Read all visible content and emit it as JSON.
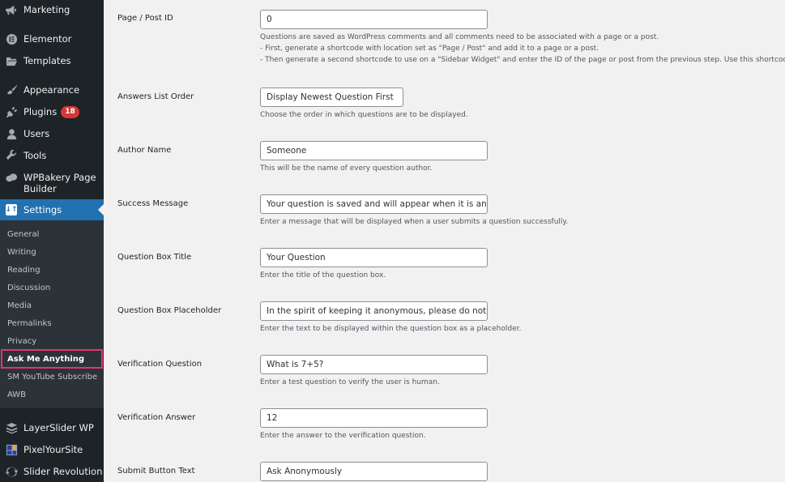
{
  "sidebar": {
    "items": [
      {
        "label": "Marketing",
        "icon": "megaphone-icon"
      },
      {
        "label": "Elementor",
        "icon": "elementor-icon"
      },
      {
        "label": "Templates",
        "icon": "folder-icon"
      },
      {
        "label": "Appearance",
        "icon": "paintbrush-icon"
      },
      {
        "label": "Plugins",
        "icon": "plugin-icon",
        "badge": "18"
      },
      {
        "label": "Users",
        "icon": "user-icon"
      },
      {
        "label": "Tools",
        "icon": "wrench-icon"
      },
      {
        "label": "WPBakery Page Builder",
        "icon": "wpbakery-cloud-icon"
      },
      {
        "label": "LayerSlider WP",
        "icon": "layers-icon"
      },
      {
        "label": "PixelYourSite",
        "icon": "pixelyoursite-icon"
      },
      {
        "label": "Slider Revolution",
        "icon": "refresh-icon"
      }
    ],
    "settings": {
      "label": "Settings",
      "icon": "settings-sliders-icon",
      "submenu": [
        "General",
        "Writing",
        "Reading",
        "Discussion",
        "Media",
        "Permalinks",
        "Privacy",
        "Ask Me Anything",
        "SM YouTube Subscribe",
        "AWB"
      ],
      "current": "Ask Me Anything"
    }
  },
  "form": {
    "page_post_id": {
      "label": "Page / Post ID",
      "value": "0",
      "desc": [
        "Questions are saved as WordPress comments and all comments need to be associated with a page or a post.",
        "- First, generate a shortcode with location set as \"Page / Post\" and add it to a page or a post.",
        "- Then generate a second shortcode to use on a \"Sidebar Widget\" and enter the ID of the page or post from the previous step. Use this shortcode"
      ]
    },
    "answers_order": {
      "label": "Answers List Order",
      "value": "Display Newest Question First",
      "desc": "Choose the order in which questions are to be displayed."
    },
    "author_name": {
      "label": "Author Name",
      "value": "Someone",
      "desc": "This will be the name of every question author."
    },
    "success_message": {
      "label": "Success Message",
      "value": "Your question is saved and will appear when it is answered",
      "desc": "Enter a message that will be displayed when a user submits a question successfully."
    },
    "question_box_title": {
      "label": "Question Box Title",
      "value": "Your Question",
      "desc": "Enter the title of the question box."
    },
    "question_box_placeholder": {
      "label": "Question Box Placeholder",
      "value": "In the spirit of keeping it anonymous, please do not leave any personal information",
      "desc": "Enter the text to be displayed within the question box as a placeholder."
    },
    "verification_question": {
      "label": "Verification Question",
      "value": "What is 7+5?",
      "desc": "Enter a test question to verify the user is human."
    },
    "verification_answer": {
      "label": "Verification Answer",
      "value": "12",
      "desc": "Enter the answer to the verification question."
    },
    "submit_button_text": {
      "label": "Submit Button Text",
      "value": "Ask Anonymously"
    }
  },
  "colors": {
    "sidebar_bg": "#1d2327",
    "submenu_bg": "#2c3338",
    "accent": "#2271b1",
    "badge": "#d63638",
    "highlight": "#e8336a"
  }
}
